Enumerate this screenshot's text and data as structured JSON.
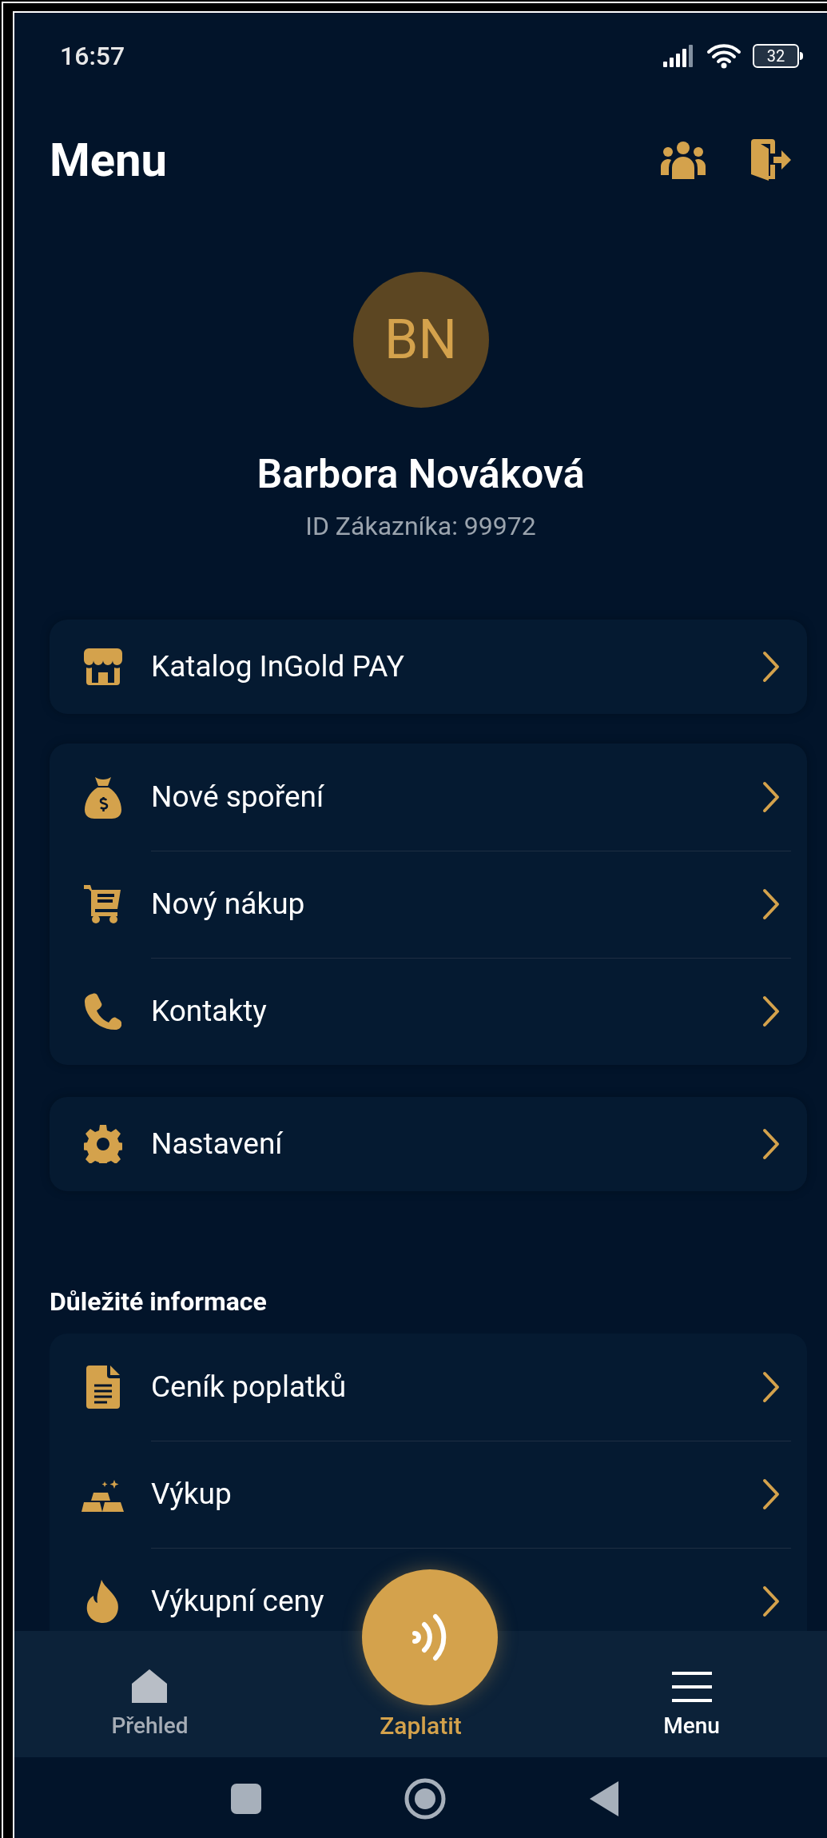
{
  "status_bar": {
    "time": "16:57",
    "battery": "32"
  },
  "header": {
    "title": "Menu"
  },
  "profile": {
    "initials": "BN",
    "name": "Barbora Nováková",
    "customer_id": "ID Zákazníka: 99972"
  },
  "menu_groups": [
    {
      "items": [
        {
          "label": "Katalog InGold PAY"
        }
      ]
    },
    {
      "items": [
        {
          "label": "Nové spoření"
        },
        {
          "label": "Nový nákup"
        },
        {
          "label": "Kontakty"
        }
      ]
    },
    {
      "items": [
        {
          "label": "Nastavení"
        }
      ]
    }
  ],
  "info_section": {
    "heading": "Důležité informace",
    "items": [
      {
        "label": "Ceník poplatků"
      },
      {
        "label": "Výkup"
      },
      {
        "label": "Výkupní ceny"
      }
    ]
  },
  "bottom_nav": [
    {
      "label": "Přehled",
      "kind": "home",
      "selected": false
    },
    {
      "label": "Zaplatit",
      "kind": "pay",
      "selected": false
    },
    {
      "label": "Menu",
      "kind": "menu",
      "selected": true
    }
  ]
}
